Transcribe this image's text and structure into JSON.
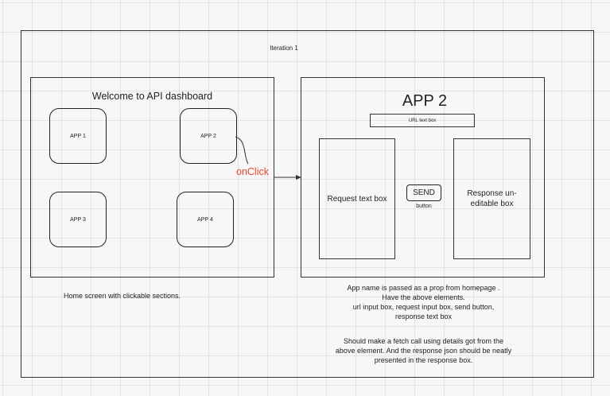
{
  "iteration_label": "Iteration 1",
  "home": {
    "title": "Welcome to API dashboard",
    "apps": [
      "APP 1",
      "APP 2",
      "APP 3",
      "APP 4"
    ],
    "caption": "Home screen with clickable sections."
  },
  "connector": {
    "label": "onClick",
    "label_color": "#e8462a"
  },
  "app_page": {
    "title": "APP 2",
    "url_box": "URL text box",
    "request_box": "Request text box",
    "send_button": "SEND",
    "send_caption": "button",
    "response_box": "Response un-editable box"
  },
  "notes": {
    "para1": [
      "App name is passed as a prop from homepage .",
      "Have the above elements.",
      "url input box, request input box, send button,",
      "response text box"
    ],
    "para2": [
      "Should make a fetch call using details got from the",
      "above element. And the response json should be neatly",
      "presented in the response box."
    ]
  }
}
